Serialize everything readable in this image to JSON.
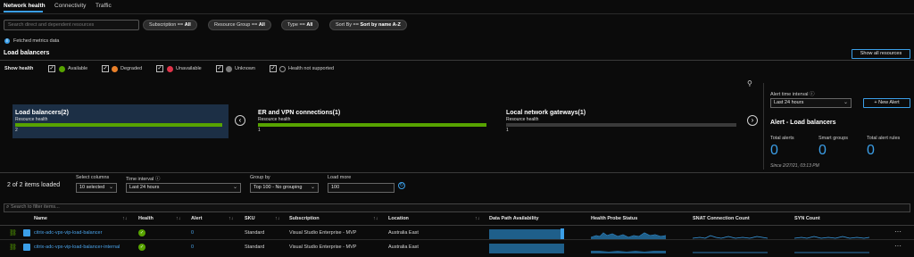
{
  "tabs": [
    "Network health",
    "Connectivity",
    "Traffic"
  ],
  "search": {
    "placeholder": "Search direct and dependent resources"
  },
  "filters": [
    {
      "label": "Subscription == ",
      "value": "All"
    },
    {
      "label": "Resource Group == ",
      "value": "All"
    },
    {
      "label": "Type == ",
      "value": "All"
    },
    {
      "label": "Sort By == ",
      "value": "Sort by name A-Z"
    }
  ],
  "info": {
    "text": "Fetched metrics data"
  },
  "section": {
    "title": "Load balancers",
    "show_all": "Show all resources"
  },
  "show_health": {
    "label": "Show health",
    "items": [
      {
        "label": "Available",
        "color": "#57a300"
      },
      {
        "label": "Degraded",
        "color": "#e9802a"
      },
      {
        "label": "Unavailable",
        "color": "#e0344a"
      },
      {
        "label": "Unknown",
        "color": "#7a7a7a"
      },
      {
        "label": "Health not supported",
        "color": "#0b0b0b"
      }
    ]
  },
  "cards": [
    {
      "title": "Load balancers(2)",
      "sub": "Resource health",
      "count": "2",
      "fill": 1.0
    },
    {
      "title": "ER and VPN connections(1)",
      "sub": "Resource health",
      "count": "1",
      "fill": 1.0
    },
    {
      "title": "Local network gateways(1)",
      "sub": "Resource health",
      "count": "1",
      "fill": 0.0
    }
  ],
  "alerts": {
    "interval_label": "Alert time interval",
    "interval_value": "Last 24 hours",
    "new_alert": "+ New Alert",
    "title": "Alert - Load balancers",
    "total_alerts_label": "Total alerts",
    "total_alerts": "0",
    "smart_groups_label": "Smart groups",
    "smart_groups": "0",
    "total_rules_label": "Total alert rules",
    "total_rules": "0",
    "since": "Since 2/27/21, 03:13 PM"
  },
  "grid_controls": {
    "loaded": "2 of 2 items loaded",
    "select_columns_label": "Select columns",
    "select_columns_value": "10 selected",
    "time_interval_label": "Time interval",
    "time_interval_value": "Last 24 hours",
    "group_by_label": "Group by",
    "group_by_value": "Top 100 - No grouping",
    "load_more_label": "Load more",
    "load_more_value": "100",
    "filter_placeholder": "Search to filter items..."
  },
  "columns": [
    "Name",
    "Health",
    "Alert",
    "SKU",
    "Subscription",
    "Location",
    "Data Path Availability",
    "Health Probe Status",
    "SNAT Connection Count",
    "SYN Count"
  ],
  "rows": [
    {
      "name": "citrix-adc-vpx-vip-load-balancer",
      "alert": "0",
      "sku": "Standard",
      "subscription": "Visual Studio Enterprise - MVP",
      "location": "Australia East"
    },
    {
      "name": "citrix-adc-vpx-vip-load-balancer-internal",
      "alert": "0",
      "sku": "Standard",
      "subscription": "Visual Studio Enterprise - MVP",
      "location": "Australia East"
    }
  ],
  "colors": {
    "accent": "#3b9fe8",
    "green": "#57a300",
    "selected_card": "#1c2f45"
  }
}
